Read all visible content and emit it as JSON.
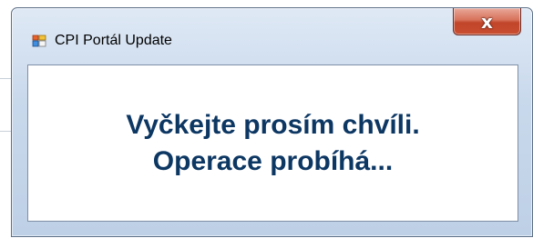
{
  "window": {
    "title": "CPI Portál Update",
    "close_label": "x"
  },
  "message": {
    "line1": "Vyčkejte prosím chvíli.",
    "line2": "Operace probíhá..."
  },
  "colors": {
    "message_text": "#0d3763",
    "close_button": "#c94d2f",
    "frame": "#c9d9ec"
  },
  "icons": {
    "app": "application-window-icon",
    "close": "close-icon"
  }
}
